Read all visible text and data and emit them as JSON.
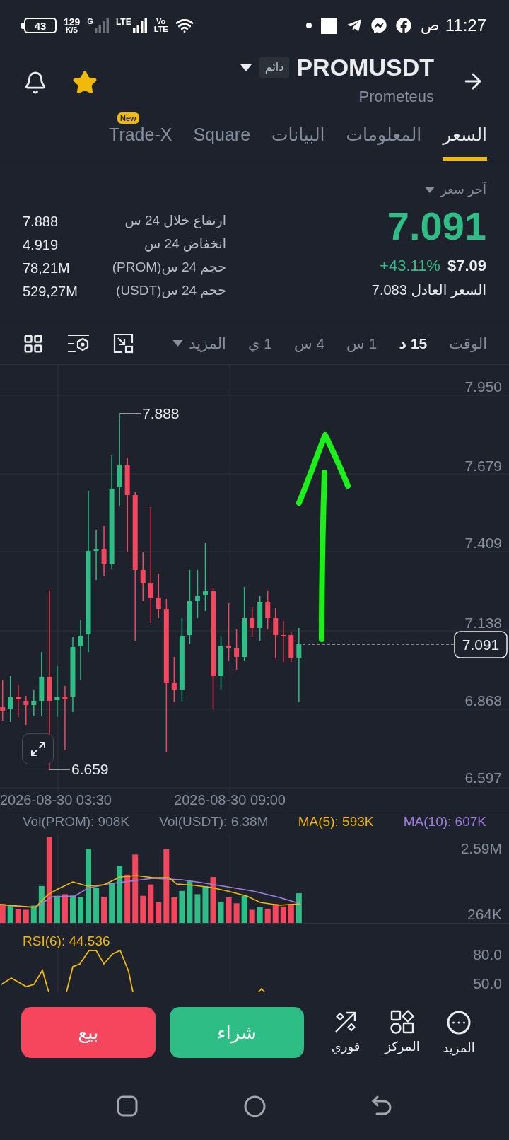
{
  "status_bar": {
    "battery": "43",
    "speed": "129",
    "speed_unit": "K/S",
    "network_1": "G",
    "network_2": "LTE",
    "volte": "Vo",
    "volte_sub": "LTE",
    "meridiem": "ص",
    "time": "11:27"
  },
  "header": {
    "symbol": "PROMUSDT",
    "contract_type": "دائم",
    "name": "Prometeus",
    "favorite": true
  },
  "tabs": [
    {
      "label": "السعر",
      "selected": true
    },
    {
      "label": "المعلومات",
      "selected": false
    },
    {
      "label": "البيانات",
      "selected": false
    },
    {
      "label": "Square",
      "selected": false
    },
    {
      "label": "Trade-X",
      "selected": false,
      "badge": "New"
    }
  ],
  "price_panel": {
    "selector": "آخر سعر",
    "last_price": "7.091",
    "change": "+43.11%",
    "usd_price": "$7.09",
    "fair_price": "السعر العادل 7.083"
  },
  "stats": [
    {
      "label": "ارتفاع خلال 24 س",
      "value": "7.888"
    },
    {
      "label": "انخفاض 24 س",
      "value": "4.919"
    },
    {
      "label": "حجم 24 س(PROM)",
      "value": "78,21M"
    },
    {
      "label": "حجم 24 س(USDT)",
      "value": "529,27M"
    }
  ],
  "toolbar": {
    "time_label": "الوقت",
    "intervals": [
      {
        "label": "15 د",
        "selected": true
      },
      {
        "label": "1 س",
        "selected": false
      },
      {
        "label": "4 س",
        "selected": false
      },
      {
        "label": "1 ي",
        "selected": false
      }
    ],
    "more": "المزيد"
  },
  "price_chart": {
    "y_labels": [
      "7.950",
      "7.679",
      "7.409",
      "7.138",
      "6.868",
      "6.597"
    ],
    "x_labels": [
      "2026-08-30 09:00",
      "2026-08-30 03:30"
    ],
    "high_label": "7.888",
    "low_label": "6.659",
    "last_price_tag": "7.091"
  },
  "volume": {
    "legend": [
      {
        "text": "MA(10): 607K",
        "color": "#a07fe0"
      },
      {
        "text": "MA(5): 593K",
        "color": "#f0b90b"
      },
      {
        "text": "Vol(USDT): 6.38M",
        "color": "#848e9c"
      },
      {
        "text": "Vol(PROM): 908K",
        "color": "#848e9c"
      }
    ],
    "y_labels": [
      "2.59M",
      "264K"
    ]
  },
  "rsi": {
    "legend": "RSI(6): 44.536",
    "y_labels": [
      "80.0",
      "50.0"
    ]
  },
  "actions": {
    "sell": "بيع",
    "buy": "شراء",
    "tools": [
      {
        "label": "المزيد"
      },
      {
        "label": "المركز"
      },
      {
        "label": "فوري"
      }
    ]
  }
}
